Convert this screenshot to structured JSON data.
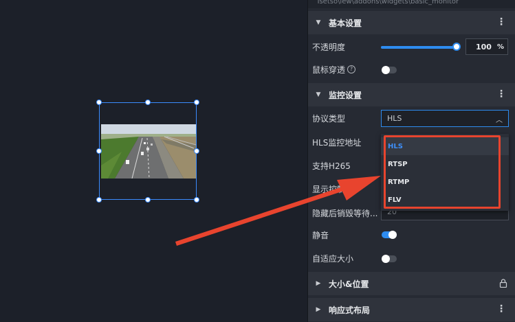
{
  "path_text": "Tsetso\\iew\\addons\\widgets\\basic_monitor",
  "sections": {
    "basic": {
      "title": "基本设置",
      "expanded": true
    },
    "monitor": {
      "title": "监控设置",
      "expanded": true
    },
    "size_position": {
      "title": "大小&位置",
      "expanded": false
    },
    "responsive": {
      "title": "响应式布局",
      "expanded": false
    }
  },
  "opacity": {
    "label": "不透明度",
    "value": "100",
    "unit": "%",
    "level": 1.0
  },
  "mouse_through": {
    "label": "鼠标穿透",
    "help": "?",
    "on": false
  },
  "protocol": {
    "label": "协议类型",
    "selected": "HLS",
    "options": [
      "HLS",
      "RTSP",
      "RTMP",
      "FLV"
    ]
  },
  "hls_url": {
    "label": "HLS监控地址"
  },
  "h265": {
    "label": "支持H265"
  },
  "show_controls": {
    "label": "显示控制条"
  },
  "hide_wait": {
    "label": "隐藏后销毁等待...",
    "value": "20"
  },
  "mute": {
    "label": "静音",
    "on": true
  },
  "autosize": {
    "label": "自适应大小",
    "on": false
  },
  "colors": {
    "accent": "#2e8cf0",
    "highlight": "#e8442e",
    "panel": "#262a33",
    "canvas": "#1c2029"
  }
}
